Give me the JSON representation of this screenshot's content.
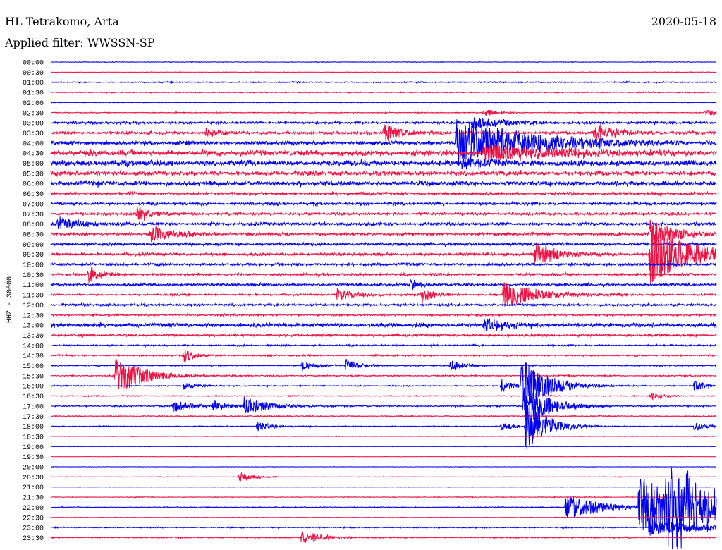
{
  "header": {
    "station": "HL Tetrakomo, Arta",
    "date": "2020-05-18",
    "filter": "Applied filter: WWSSN-SP"
  },
  "chart_data": {
    "type": "line",
    "ylabel": "HHZ - 30000",
    "row_labels": [
      "00:00",
      "00:30",
      "01:00",
      "01:30",
      "02:00",
      "02:30",
      "03:00",
      "03:30",
      "04:00",
      "04:30",
      "05:00",
      "05:30",
      "06:00",
      "06:30",
      "07:00",
      "07:30",
      "08:00",
      "08:30",
      "09:00",
      "09:30",
      "10:00",
      "10:30",
      "11:00",
      "11:30",
      "12:00",
      "12:30",
      "13:00",
      "13:30",
      "14:00",
      "14:30",
      "15:00",
      "15:30",
      "16:00",
      "16:30",
      "17:00",
      "17:30",
      "18:00",
      "18:30",
      "19:00",
      "19:30",
      "20:00",
      "20:30",
      "21:00",
      "21:30",
      "22:00",
      "22:30",
      "23:00",
      "23:30"
    ],
    "row_minutes": 30,
    "colors": [
      "#0000ee",
      "#ee1144"
    ],
    "row_noise_level": [
      0.3,
      0.3,
      0.6,
      0.6,
      0.3,
      0.5,
      1.3,
      1.5,
      2.0,
      3.0,
      2.8,
      2.3,
      2.5,
      1.5,
      1.5,
      1.5,
      1.6,
      1.5,
      1.6,
      1.5,
      1.4,
      1.3,
      1.3,
      1.0,
      1.2,
      1.0,
      2.2,
      1.3,
      0.8,
      0.8,
      0.6,
      0.7,
      0.6,
      0.5,
      0.7,
      0.6,
      0.5,
      0.3,
      0.2,
      0.2,
      0.2,
      0.3,
      0.2,
      0.4,
      0.5,
      0.3,
      0.6,
      0.6
    ],
    "events": [
      {
        "row": 5,
        "minute": 19.5,
        "amp": 6,
        "dur": 1.0
      },
      {
        "row": 5,
        "minute": 29.5,
        "amp": 6,
        "dur": 1.0
      },
      {
        "row": 6,
        "minute": 19.0,
        "amp": 9,
        "dur": 3.0
      },
      {
        "row": 7,
        "minute": 7.0,
        "amp": 8,
        "dur": 1.2
      },
      {
        "row": 7,
        "minute": 15.0,
        "amp": 14,
        "dur": 1.5
      },
      {
        "row": 7,
        "minute": 24.5,
        "amp": 14,
        "dur": 2.0
      },
      {
        "row": 8,
        "minute": 18.3,
        "amp": 35,
        "dur": 6.0
      },
      {
        "row": 9,
        "minute": 19.5,
        "amp": 14,
        "dur": 6.0
      },
      {
        "row": 10,
        "minute": 18.5,
        "amp": 8,
        "dur": 3.0
      },
      {
        "row": 15,
        "minute": 3.9,
        "amp": 10,
        "dur": 1.5
      },
      {
        "row": 16,
        "minute": 0.3,
        "amp": 12,
        "dur": 2.0
      },
      {
        "row": 17,
        "minute": 4.5,
        "amp": 12,
        "dur": 2.0
      },
      {
        "row": 17,
        "minute": 27.0,
        "amp": 22,
        "dur": 2.0
      },
      {
        "row": 19,
        "minute": 21.8,
        "amp": 18,
        "dur": 2.0
      },
      {
        "row": 19,
        "minute": 27.0,
        "amp": 45,
        "dur": 3.0
      },
      {
        "row": 21,
        "minute": 1.7,
        "amp": 14,
        "dur": 0.8
      },
      {
        "row": 22,
        "minute": 16.2,
        "amp": 8,
        "dur": 1.0
      },
      {
        "row": 23,
        "minute": 12.9,
        "amp": 10,
        "dur": 1.5
      },
      {
        "row": 23,
        "minute": 16.7,
        "amp": 12,
        "dur": 1.0
      },
      {
        "row": 23,
        "minute": 20.4,
        "amp": 18,
        "dur": 3.0
      },
      {
        "row": 26,
        "minute": 19.5,
        "amp": 10,
        "dur": 2.0
      },
      {
        "row": 29,
        "minute": 6.0,
        "amp": 10,
        "dur": 1.0
      },
      {
        "row": 30,
        "minute": 11.3,
        "amp": 8,
        "dur": 1.0
      },
      {
        "row": 30,
        "minute": 13.3,
        "amp": 10,
        "dur": 1.0
      },
      {
        "row": 30,
        "minute": 18.0,
        "amp": 10,
        "dur": 1.0
      },
      {
        "row": 31,
        "minute": 2.9,
        "amp": 30,
        "dur": 2.0
      },
      {
        "row": 32,
        "minute": 6.0,
        "amp": 6,
        "dur": 1.0
      },
      {
        "row": 32,
        "minute": 20.3,
        "amp": 10,
        "dur": 1.0
      },
      {
        "row": 32,
        "minute": 21.2,
        "amp": 40,
        "dur": 2.0
      },
      {
        "row": 32,
        "minute": 29.0,
        "amp": 8,
        "dur": 1.0
      },
      {
        "row": 33,
        "minute": 27.0,
        "amp": 6,
        "dur": 1.0
      },
      {
        "row": 34,
        "minute": 5.5,
        "amp": 10,
        "dur": 1.5
      },
      {
        "row": 34,
        "minute": 7.3,
        "amp": 10,
        "dur": 1.0
      },
      {
        "row": 34,
        "minute": 8.7,
        "amp": 14,
        "dur": 2.0
      },
      {
        "row": 34,
        "minute": 21.3,
        "amp": 30,
        "dur": 2.0
      },
      {
        "row": 36,
        "minute": 9.3,
        "amp": 8,
        "dur": 1.0
      },
      {
        "row": 36,
        "minute": 20.3,
        "amp": 6,
        "dur": 1.0
      },
      {
        "row": 36,
        "minute": 29.0,
        "amp": 6,
        "dur": 1.0
      },
      {
        "row": 36,
        "minute": 21.4,
        "amp": 40,
        "dur": 1.5
      },
      {
        "row": 41,
        "minute": 8.5,
        "amp": 8,
        "dur": 1.0
      },
      {
        "row": 44,
        "minute": 23.2,
        "amp": 20,
        "dur": 2.5
      },
      {
        "row": 44,
        "minute": 26.5,
        "amp": 45,
        "dur": 4.5
      },
      {
        "row": 44,
        "minute": 27.7,
        "amp": 55,
        "dur": 4.0
      },
      {
        "row": 44,
        "minute": 29.2,
        "amp": 10,
        "dur": 1.0
      },
      {
        "row": 46,
        "minute": 27.0,
        "amp": 12,
        "dur": 4.0
      },
      {
        "row": 47,
        "minute": 11.3,
        "amp": 10,
        "dur": 1.5
      }
    ]
  }
}
